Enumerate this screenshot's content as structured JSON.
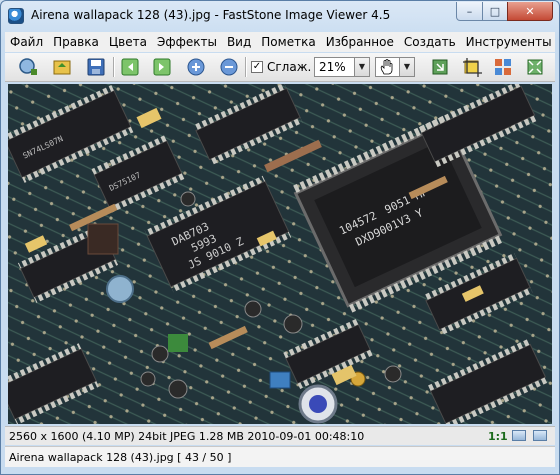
{
  "window": {
    "title": "Airena wallapack 128 (43).jpg  -  FastStone Image Viewer 4.5",
    "minimize_glyph": "–",
    "maximize_glyph": "□",
    "close_glyph": "✕"
  },
  "menu": {
    "items": [
      "Файл",
      "Правка",
      "Цвета",
      "Эффекты",
      "Вид",
      "Пометка",
      "Избранное",
      "Создать",
      "Инструменты"
    ]
  },
  "toolbar": {
    "buttons": [
      "open-folder-icon",
      "browse-icon",
      "save-icon",
      "previous-icon",
      "next-icon",
      "zoom-in-icon",
      "zoom-out-icon"
    ],
    "smooth_checked": true,
    "smooth_check_glyph": "✓",
    "smooth_label": "Сглаж.",
    "zoom_value": "21%",
    "dropdown_glyph": "▼",
    "pan_tool": "hand-icon",
    "right_buttons": [
      "resize-icon",
      "crop-icon",
      "thumbnails-icon",
      "fullscreen-icon"
    ]
  },
  "viewer": {
    "chips": [
      {
        "label": "9051 MP"
      },
      {
        "label": "104572"
      },
      {
        "label": "DXD9001V3 Y"
      },
      {
        "label": "DAB703"
      },
      {
        "label": "5993"
      },
      {
        "label": "JS 9010 Z"
      },
      {
        "label": "SN74LS07N"
      },
      {
        "label": "DS75107"
      }
    ]
  },
  "status": {
    "info": "2560 x 1600 (4.10 MP)  24bit  JPEG   1.28 MB   2010-09-01 00:48:10",
    "ratio": "1:1"
  },
  "file": {
    "info": "Airena wallapack 128 (43).jpg [ 43 / 50 ]"
  },
  "colors": {
    "title_bar": "#dbe8f6",
    "board": "#1a2a2e",
    "chip": "#1e1e22",
    "trace": "#5d7a6a",
    "close_button": "#c44a36"
  }
}
